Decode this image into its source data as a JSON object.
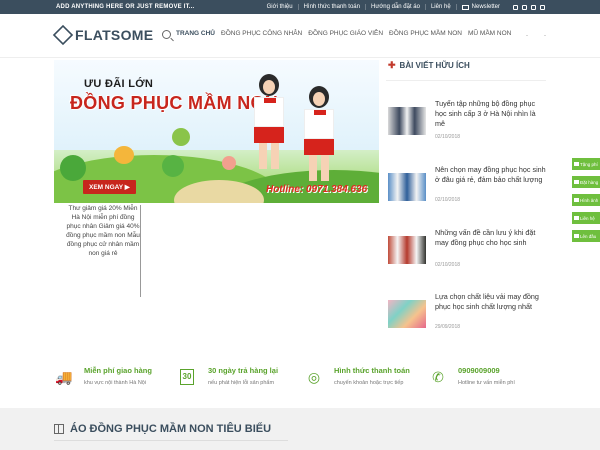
{
  "topbar": {
    "promo": "ADD ANYTHING HERE OR JUST REMOVE IT...",
    "links": [
      "Giới thiệu",
      "Hình thức thanh toán",
      "Hướng dẫn đặt áo",
      "Liên hệ"
    ],
    "newsletter": "Newsletter",
    "social_icons": [
      "facebook-icon",
      "instagram-icon",
      "twitter-icon",
      "email-icon"
    ]
  },
  "header": {
    "logo": "FLATSOME",
    "nav": [
      {
        "label": "TRANG CHỦ",
        "active": true
      },
      {
        "label": "ĐỒNG PHỤC CÔNG NHÂN",
        "active": false
      },
      {
        "label": "ĐỒNG PHỤC GIÁO VIÊN",
        "active": false
      },
      {
        "label": "ĐỒNG PHỤC MẦM NON",
        "active": false
      },
      {
        "label": "MŨ MẦM NON",
        "active": false
      }
    ],
    "right_dots": [
      "-",
      "-"
    ]
  },
  "banner": {
    "headline": "ƯU ĐÃI LỚN",
    "title": "ĐỒNG PHỤC MẦM NON",
    "cta": "XEM NGAY",
    "hotline": "Hotline: 0971.384.636"
  },
  "slider_text": "Thư giảm giá 20% Miễn Hà Nội miễn phí đồng phục nhân Giảm giá 40% đồng phục mầm non Mẫu đồng phục cử nhân mầm non giá rẻ",
  "sidebar": {
    "title": "BÀI VIẾT HỮU ÍCH",
    "posts": [
      {
        "title": "Tuyển tập những bộ đồng phục học sinh cấp 3 ở Hà Nội nhìn là mê",
        "date": "02/10/2018"
      },
      {
        "title": "Nên chọn may đồng phục học sinh ở đâu giá rẻ, đảm bảo chất lượng",
        "date": "02/10/2018"
      },
      {
        "title": "Những vấn đề cần lưu ý khi đặt may đồng phục cho học sinh",
        "date": "02/10/2018"
      },
      {
        "title": "Lựa chọn chất liệu vải may đồng phục học sinh chất lượng nhất",
        "date": "29/09/2018"
      }
    ]
  },
  "float_buttons": [
    "Tặng phí",
    "Đặt hàng",
    "Hình ảnh",
    "Liên hệ",
    "Lên đầu"
  ],
  "features": [
    {
      "title": "Miễn phí giao hàng",
      "sub": "khu vực nội thành Hà Nội",
      "icon": "truck-icon"
    },
    {
      "title": "30 ngày trả hàng lại",
      "sub": "nếu phát hiện lỗi sản phẩm",
      "icon": "calendar-30-icon"
    },
    {
      "title": "Hình thức thanh toán",
      "sub": "chuyển khoản hoặc trực tiếp",
      "icon": "money-icon"
    },
    {
      "title": "0909009009",
      "sub": "Hotline tư vấn miễn phí",
      "icon": "phone-icon"
    }
  ],
  "section": {
    "title": "ÁO ĐỒNG PHỤC MẦM NON TIÊU BIỂU"
  },
  "colors": {
    "topbar": "#3b4e5e",
    "accent_green": "#5aa32c",
    "banner_red": "#c7261d"
  }
}
